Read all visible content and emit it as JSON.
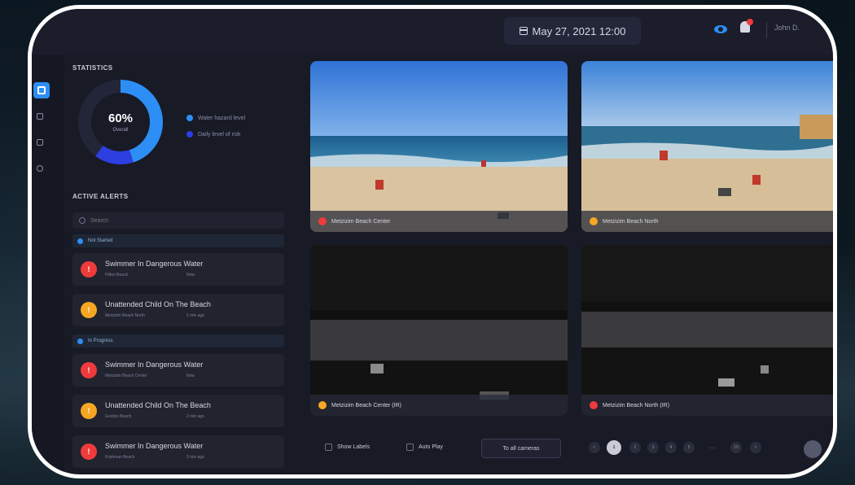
{
  "topbar": {
    "date": "May 27, 2021 12:00",
    "user_name": "John D."
  },
  "statistics": {
    "title": "STATISTICS",
    "percent": "60%",
    "percent_label": "Overall",
    "ring_fraction": 0.6,
    "legend": [
      {
        "label": "Water hazard level",
        "color": "#2d8ef5"
      },
      {
        "label": "Daily level of risk",
        "color": "#2d3fe0"
      }
    ]
  },
  "alerts": {
    "title": "ACTIVE ALERTS",
    "search_placeholder": "Search",
    "group_not_started": "Not Started",
    "group_in_progress": "In Progress",
    "items": [
      {
        "title": "Swimmer In Dangerous Water",
        "location": "Hilton Beach",
        "time": "Now",
        "color": "#ef3b3b"
      },
      {
        "title": "Unattended Child On The Beach",
        "location": "Metzizim Beach North",
        "time": "1 min ago",
        "color": "#f5a623"
      },
      {
        "title": "Swimmer In Dangerous Water",
        "location": "Metzizim Beach Center",
        "time": "Now",
        "color": "#ef3b3b"
      },
      {
        "title": "Unattended Child On The Beach",
        "location": "Gordon Beach",
        "time": "2 min ago",
        "color": "#f5a623"
      },
      {
        "title": "Swimmer In Dangerous Water",
        "location": "Frishman Beach",
        "time": "3 min ago",
        "color": "#ef3b3b"
      }
    ]
  },
  "cameras": [
    {
      "label": "Metzizim Beach Center",
      "status_color": "#ef3b3b"
    },
    {
      "label": "Metzizim Beach North",
      "status_color": "#f5a623"
    },
    {
      "label": "Metzizim Beach Center (IR)",
      "status_color": "#f5a623"
    },
    {
      "label": "Metzizim Beach North (IR)",
      "status_color": "#ef3b3b"
    }
  ],
  "controls": {
    "show_labels": "Show Labels",
    "auto_play": "Auto Play",
    "to_all_cameras": "To all cameras",
    "pages": [
      "<",
      "1",
      "2",
      "3",
      "4",
      "5",
      ".....",
      "10",
      ">"
    ],
    "current_page": "1"
  },
  "colors": {
    "accent": "#2d8ef5",
    "danger": "#ef3b3b",
    "warning": "#f5a623",
    "panel": "#181a26"
  }
}
